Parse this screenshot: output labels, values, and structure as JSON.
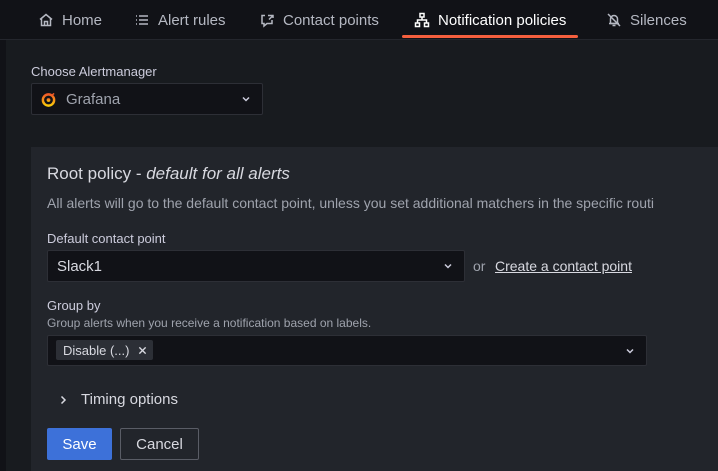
{
  "tabs": [
    {
      "label": "Home",
      "icon": "home-icon",
      "active": false
    },
    {
      "label": "Alert rules",
      "icon": "list-icon",
      "active": false
    },
    {
      "label": "Contact points",
      "icon": "comment-alt-share-icon",
      "active": false
    },
    {
      "label": "Notification policies",
      "icon": "sitemap-icon",
      "active": true
    },
    {
      "label": "Silences",
      "icon": "bell-slash-icon",
      "active": false
    }
  ],
  "alertmanager": {
    "label": "Choose Alertmanager",
    "selected": "Grafana",
    "icon": "grafana-logo-icon"
  },
  "root_policy": {
    "title": "Root policy",
    "separator": " - ",
    "subtitle": "default for all alerts",
    "description": "All alerts will go to the default contact point, unless you set additional matchers in the specific routi"
  },
  "contact_point": {
    "label": "Default contact point",
    "selected": "Slack1",
    "or_text": "or",
    "create_link": "Create a contact point"
  },
  "group_by": {
    "label": "Group by",
    "description": "Group alerts when you receive a notification based on labels.",
    "chips": [
      "Disable (...)"
    ]
  },
  "timing": {
    "label": "Timing options"
  },
  "actions": {
    "save": "Save",
    "cancel": "Cancel"
  },
  "colors": {
    "accent": "#f55f3e",
    "primary_button": "#3d71d9",
    "background": "#111217",
    "panel": "#22252b"
  }
}
